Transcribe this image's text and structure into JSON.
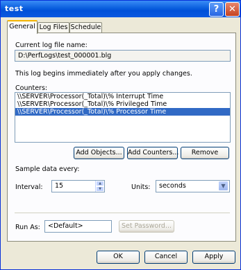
{
  "window": {
    "title": "test"
  },
  "tabs": [
    {
      "label": "General"
    },
    {
      "label": "Log Files"
    },
    {
      "label": "Schedule"
    }
  ],
  "general": {
    "current_log_label": "Current log file name:",
    "current_log_value": "D:\\PerfLogs\\test_000001.blg",
    "info_text": "This log begins immediately after you apply changes.",
    "counters_label": "Counters:",
    "counters": [
      "\\\\SERVER\\Processor(_Total)\\% Interrupt Time",
      "\\\\SERVER\\Processor(_Total)\\% Privileged Time",
      "\\\\SERVER\\Processor(_Total)\\% Processor Time"
    ],
    "add_objects_label": "Add Objects...",
    "add_counters_label": "Add Counters...",
    "remove_label": "Remove",
    "sample_label": "Sample data every:",
    "interval_label": "Interval:",
    "interval_value": "15",
    "units_label": "Units:",
    "units_value": "seconds",
    "run_as_label": "Run As:",
    "run_as_value": "<Default>",
    "set_password_label": "Set Password..."
  },
  "footer": {
    "ok_label": "OK",
    "cancel_label": "Cancel",
    "apply_label": "Apply"
  },
  "colors": {
    "titlebar": "#0a5fde",
    "selection": "#316ac5",
    "active_tab_accent": "#f4b400"
  }
}
